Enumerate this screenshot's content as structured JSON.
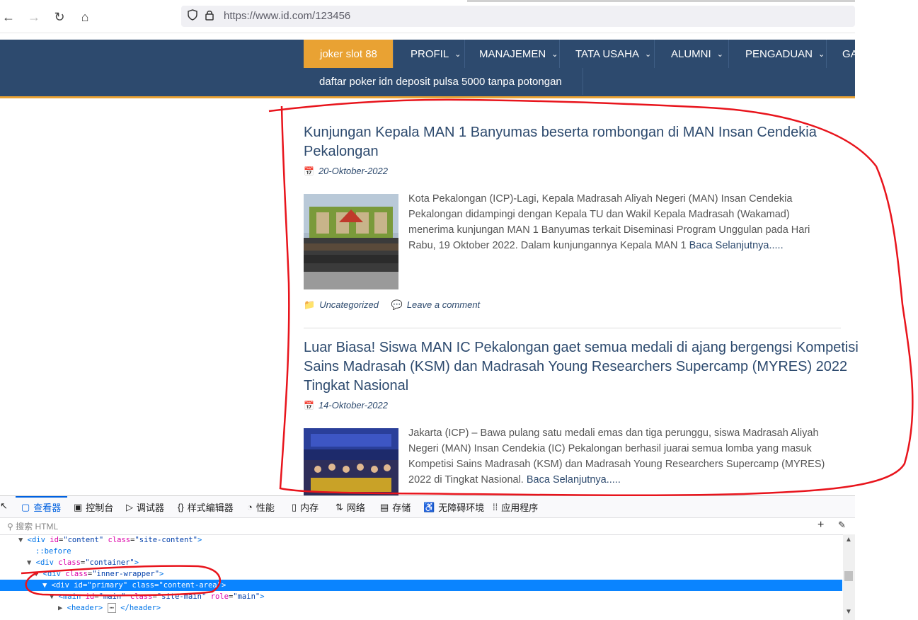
{
  "browser": {
    "url": "https://www.id.com/123456",
    "back": "←",
    "forward": "→",
    "reload": "↻",
    "home": "⌂"
  },
  "nav": {
    "items": [
      {
        "label": "joker slot 88",
        "dropdown": false,
        "active": true
      },
      {
        "label": "PROFIL",
        "dropdown": true
      },
      {
        "label": "MANAJEMEN",
        "dropdown": true
      },
      {
        "label": "TATA USAHA",
        "dropdown": true
      },
      {
        "label": "ALUMNI",
        "dropdown": true
      },
      {
        "label": "PENGADUAN",
        "dropdown": true
      },
      {
        "label": "GA",
        "dropdown": false
      }
    ],
    "row2": "daftar poker idn deposit pulsa 5000 tanpa potongan",
    "colors": {
      "bar": "#2d4a6e",
      "accent": "#e9a233"
    }
  },
  "posts": [
    {
      "title_line1": "Kunjungan Kepala MAN 1 Banyumas beserta rombongan di MAN Insan Cendekia",
      "title_line2": "Pekalongan",
      "date": "20-Oktober-2022",
      "excerpt": "Kota Pekalongan (ICP)-Lagi, Kepala Madrasah Aliyah Negeri (MAN) Insan Cendekia Pekalongan didampingi dengan Kepala TU dan Wakil Kepala Madrasah (Wakamad) menerima kunjungan MAN 1 Banyumas terkait Diseminasi Program Unggulan pada Hari Rabu, 19 Oktober 2022. Dalam kunjungannya Kepala MAN 1",
      "read_more": "Baca Selanjutnya.....",
      "category": "Uncategorized",
      "comment": "Leave a comment"
    },
    {
      "title_line1": "Luar Biasa! Siswa MAN IC Pekalongan gaet semua medali di ajang bergengsi Kompetisi",
      "title_line2": "Sains Madrasah (KSM) dan Madrasah Young Researchers Supercamp (MYRES) 2022",
      "title_line3": "Tingkat Nasional",
      "date": "14-Oktober-2022",
      "excerpt": "Jakarta (ICP) – Bawa pulang satu medali emas dan tiga perunggu, siswa Madrasah Aliyah Negeri (MAN) Insan Cendekia (IC) Pekalongan berhasil juarai semua lomba yang masuk Kompetisi Sains Madrasah (KSM) dan Madrasah Young Researchers Supercamp (MYRES) 2022 di Tingkat Nasional.",
      "read_more": "Baca Selanjutnya....."
    }
  ],
  "devtools": {
    "tabs": [
      {
        "icon": "▢",
        "label": "查看器",
        "active": true
      },
      {
        "icon": "▣",
        "label": "控制台"
      },
      {
        "icon": "▷",
        "label": "调试器"
      },
      {
        "icon": "{}",
        "label": "样式编辑器"
      },
      {
        "icon": "◔",
        "label": "性能"
      },
      {
        "icon": "▯",
        "label": "内存"
      },
      {
        "icon": "⇅",
        "label": "网络"
      },
      {
        "icon": "▤",
        "label": "存储"
      },
      {
        "icon": "♿",
        "label": "无障碍环境"
      },
      {
        "icon": "⁞⁞",
        "label": "应用程序"
      }
    ],
    "search_placeholder": "搜索 HTML",
    "add": "+",
    "picker": "✎"
  }
}
